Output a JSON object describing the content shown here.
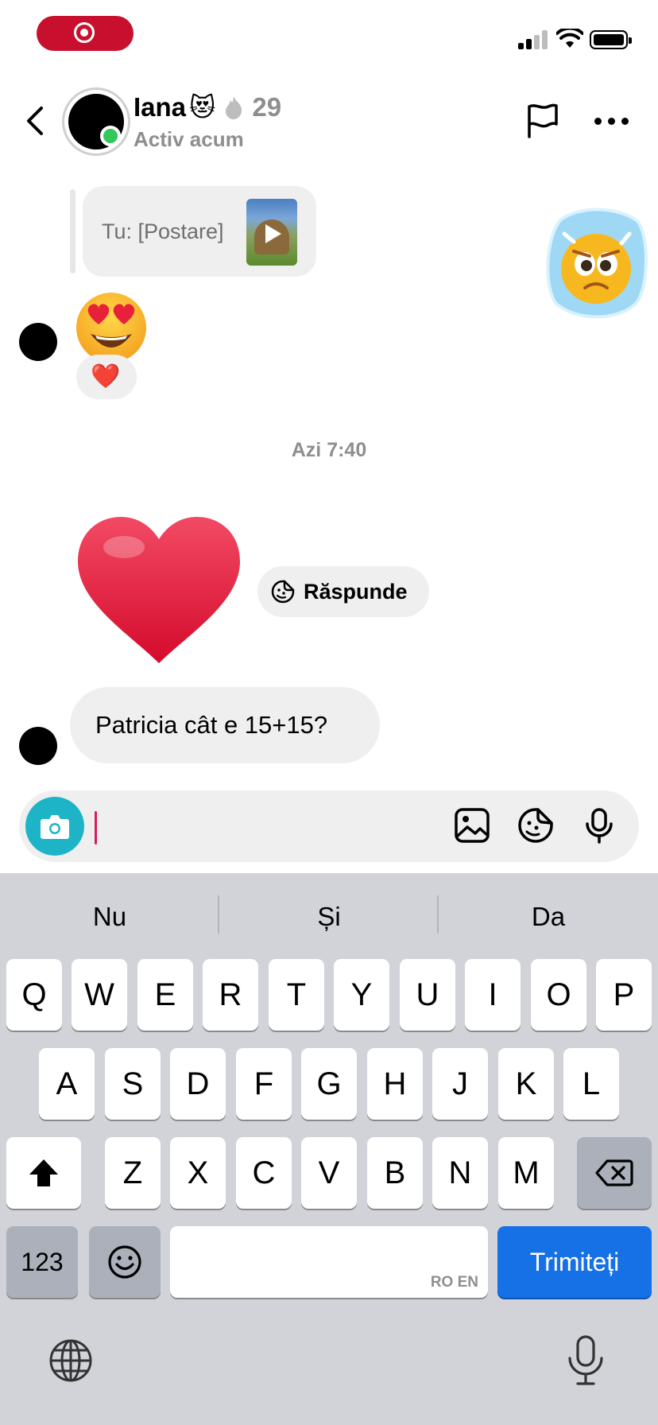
{
  "header": {
    "name": "Iana",
    "name_emoji": "😻",
    "streak_count": "29",
    "status": "Activ acum"
  },
  "messages": {
    "shared_post_label": "Tu: [Postare]",
    "reaction_emoji": "❤️",
    "timestamp": "Azi 7:40",
    "reply_label": "Răspunde",
    "text_message": "Patricia cât e 15+15?"
  },
  "keyboard": {
    "suggestions": [
      "Nu",
      "Și",
      "Da"
    ],
    "row1": [
      "Q",
      "W",
      "E",
      "R",
      "T",
      "Y",
      "U",
      "I",
      "O",
      "P"
    ],
    "row2": [
      "A",
      "S",
      "D",
      "F",
      "G",
      "H",
      "J",
      "K",
      "L"
    ],
    "row3": [
      "Z",
      "X",
      "C",
      "V",
      "B",
      "N",
      "M"
    ],
    "numbers_label": "123",
    "space_lang": "RO EN",
    "send_label": "Trimiteți"
  },
  "colors": {
    "record_pill": "#c8102e",
    "online_dot": "#34c759",
    "camera_button": "#1eb4c8",
    "send_key": "#1670e6",
    "cursor": "#d81b60"
  },
  "icons": [
    "record-icon",
    "back-icon",
    "flag-icon",
    "more-icon",
    "camera-icon",
    "gallery-icon",
    "sticker-icon",
    "mic-icon",
    "shift-icon",
    "delete-icon",
    "emoji-icon",
    "globe-icon",
    "dictation-icon"
  ]
}
